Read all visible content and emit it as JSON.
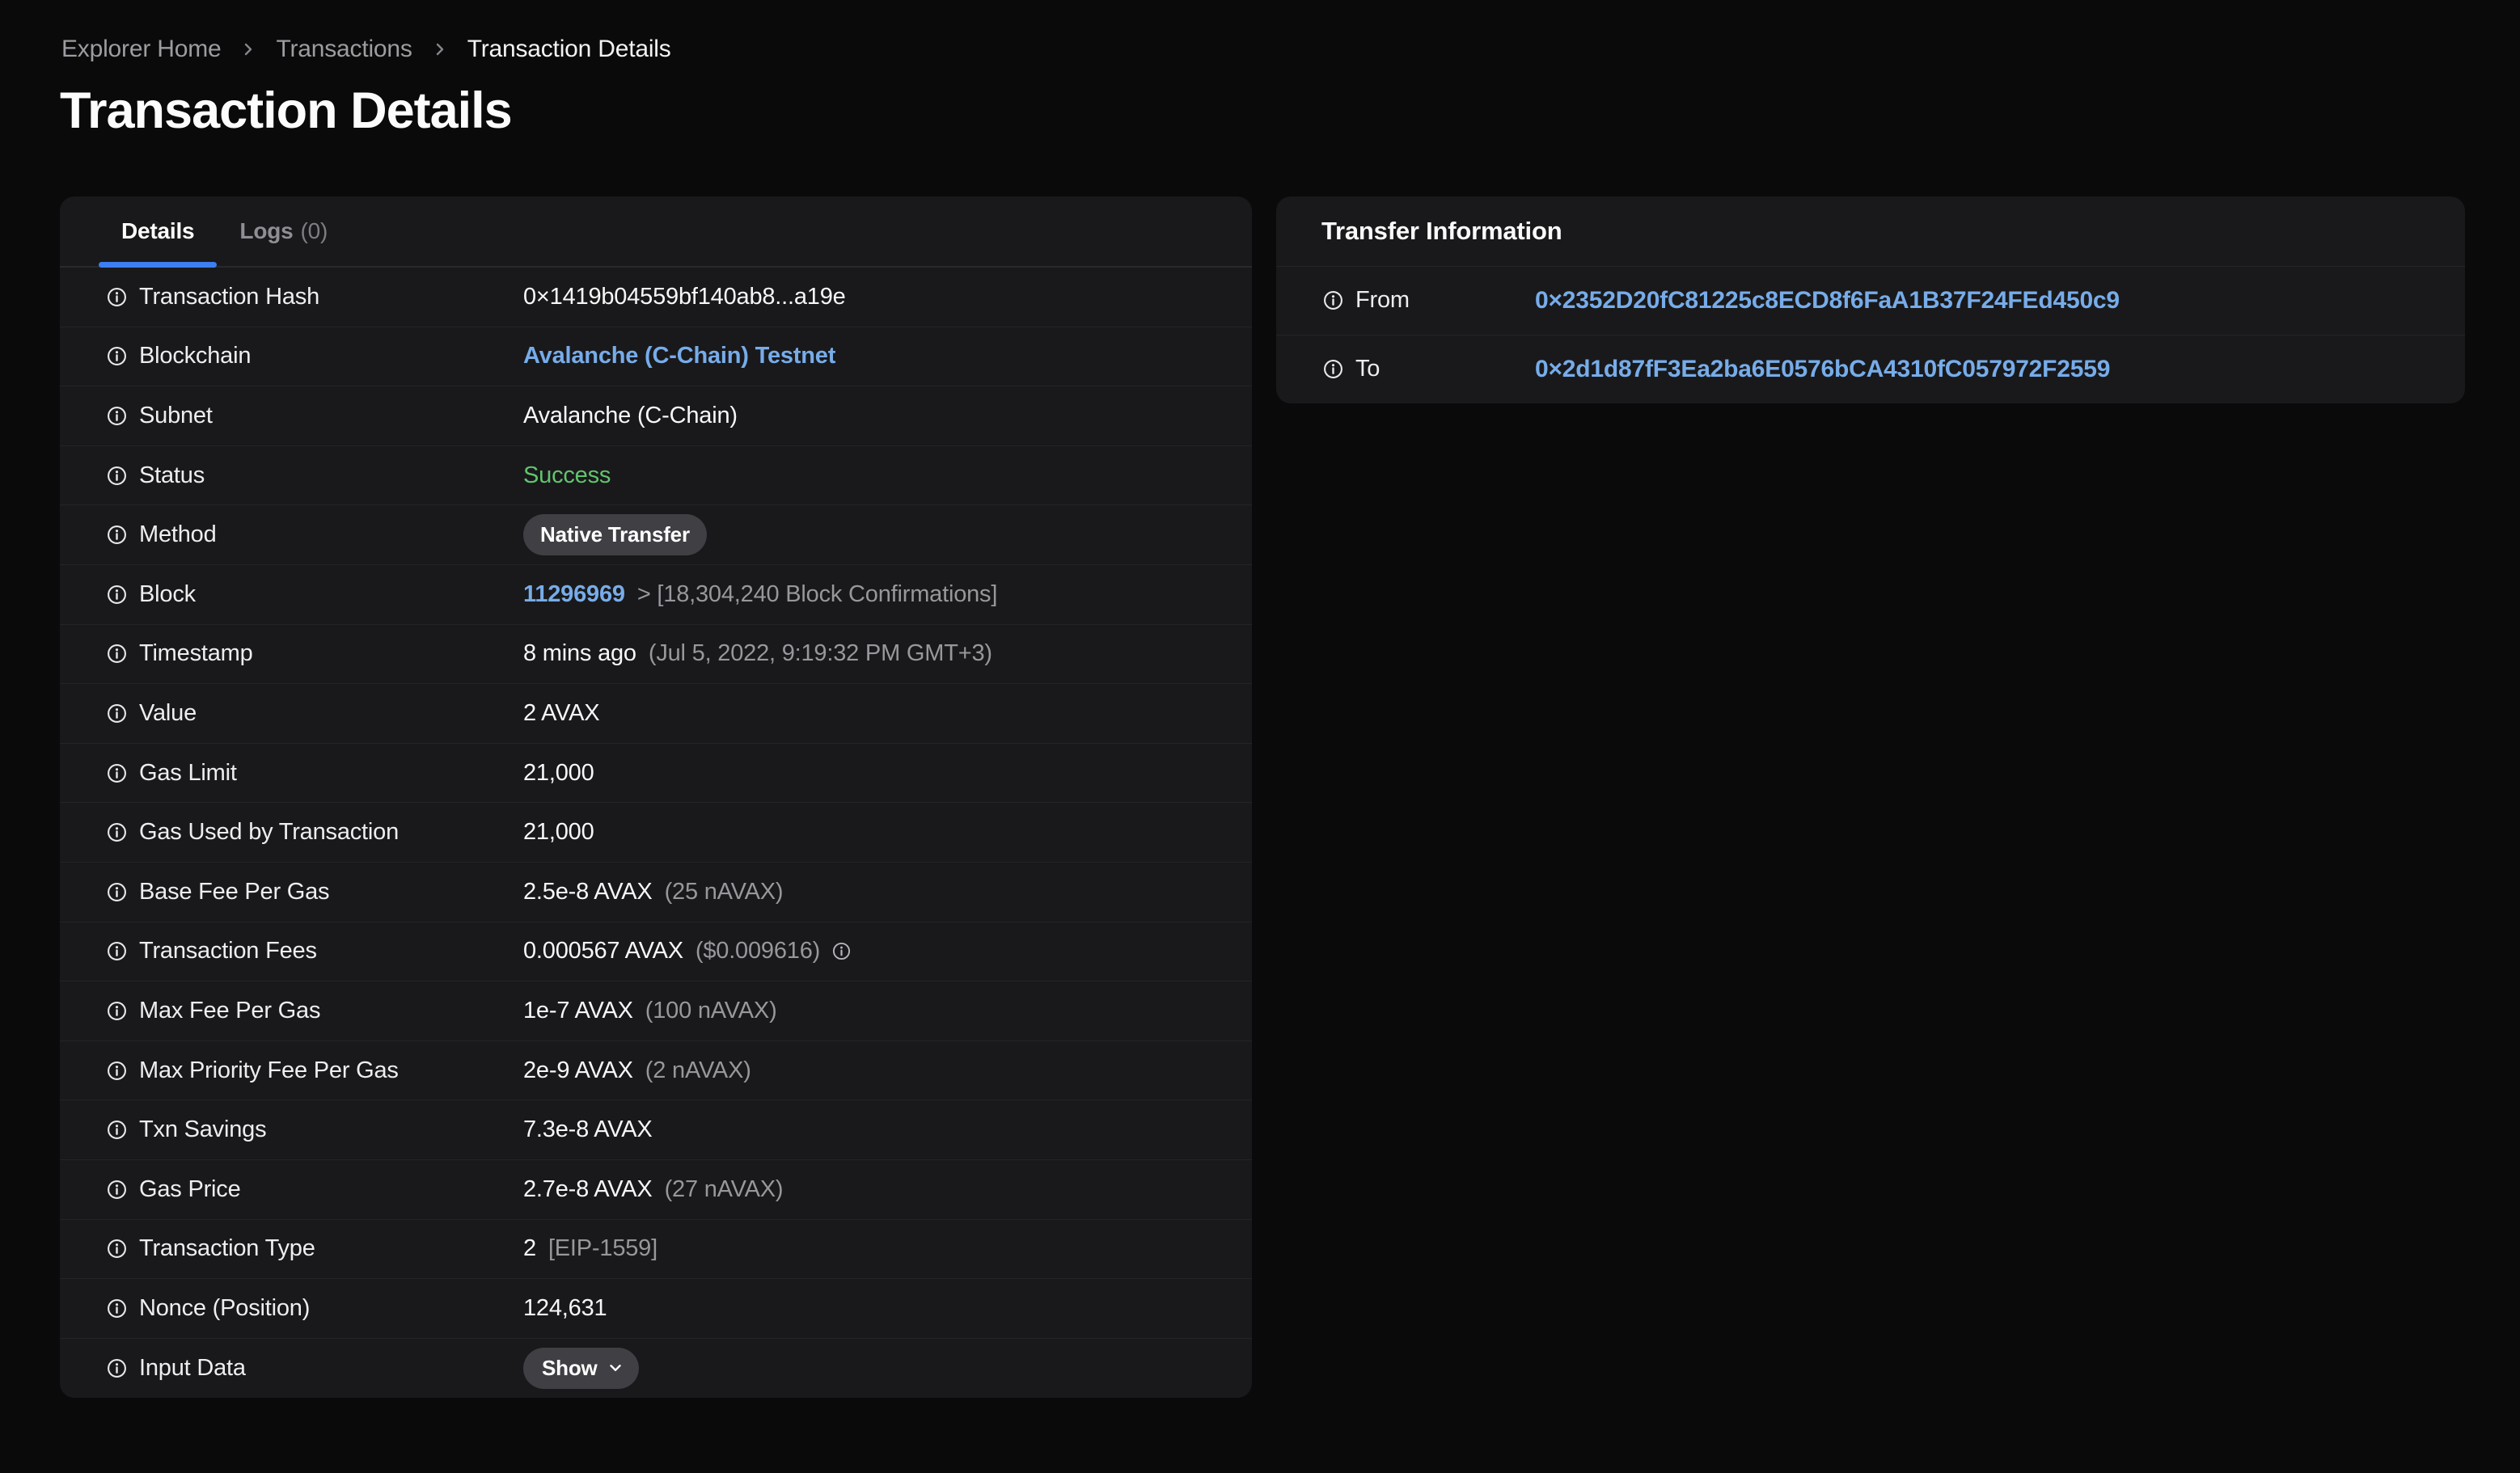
{
  "colors": {
    "page_bg": "#0a0a0b",
    "card_bg": "#19191b",
    "divider": "#242428",
    "accent_tab_underline": "#3d7ff3",
    "link_blue": "#77ace9",
    "success_green": "#62c46e",
    "muted_gray": "#97979c",
    "badge_bg": "#3f3f44"
  },
  "icons": {
    "row_label": "info-icon",
    "breadcrumb_separator": "chevron-right-icon",
    "fees_hint": "info-icon",
    "show_button": "chevron-down-icon"
  },
  "breadcrumb": {
    "items": [
      {
        "label": "Explorer Home"
      },
      {
        "label": "Transactions"
      },
      {
        "label": "Transaction Details"
      }
    ]
  },
  "page_title": "Transaction Details",
  "details_card": {
    "tabs": [
      {
        "label": "Details"
      },
      {
        "label": "Logs",
        "count": "(0)"
      }
    ],
    "rows": [
      {
        "label": "Transaction Hash",
        "value": "0×1419b04559bf140ab8...a19e"
      },
      {
        "label": "Blockchain",
        "value": "Avalanche (C-Chain) Testnet"
      },
      {
        "label": "Subnet",
        "value": "Avalanche (C-Chain)"
      },
      {
        "label": "Status",
        "value": "Success"
      },
      {
        "label": "Method",
        "value": "Native Transfer"
      },
      {
        "label": "Block",
        "value": "11296969",
        "value2": "> [18,304,240 Block Confirmations]"
      },
      {
        "label": "Timestamp",
        "value": "8 mins ago",
        "value2": "(Jul 5, 2022, 9:19:32 PM GMT+3)"
      },
      {
        "label": "Value",
        "value": "2 AVAX"
      },
      {
        "label": "Gas Limit",
        "value": "21,000"
      },
      {
        "label": "Gas Used by Transaction",
        "value": "21,000"
      },
      {
        "label": "Base Fee Per Gas",
        "value": "2.5e-8 AVAX",
        "value2": "(25 nAVAX)"
      },
      {
        "label": "Transaction Fees",
        "value": "0.000567 AVAX",
        "value2": "($0.009616)"
      },
      {
        "label": "Max Fee Per Gas",
        "value": "1e-7 AVAX",
        "value2": "(100 nAVAX)"
      },
      {
        "label": "Max Priority Fee Per Gas",
        "value": "2e-9 AVAX",
        "value2": "(2 nAVAX)"
      },
      {
        "label": "Txn Savings",
        "value": "7.3e-8 AVAX"
      },
      {
        "label": "Gas Price",
        "value": "2.7e-8 AVAX",
        "value2": "(27 nAVAX)"
      },
      {
        "label": "Transaction Type",
        "value": "2",
        "value2": "[EIP-1559]"
      },
      {
        "label": "Nonce (Position)",
        "value": "124,631"
      },
      {
        "label": "Input Data",
        "button_label": "Show"
      }
    ]
  },
  "transfer_card": {
    "title": "Transfer Information",
    "rows": [
      {
        "label": "From",
        "value": "0×2352D20fC81225c8ECD8f6FaA1B37F24FEd450c9"
      },
      {
        "label": "To",
        "value": "0×2d1d87fF3Ea2ba6E0576bCA4310fC057972F2559"
      }
    ]
  }
}
